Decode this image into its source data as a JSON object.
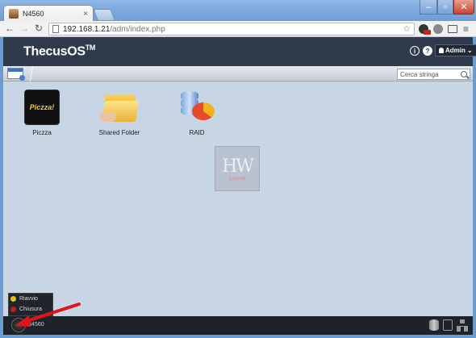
{
  "browser": {
    "tab_title": "N4560",
    "tab_close": "×",
    "window_controls": {
      "minimize": "–",
      "maximize": "▫",
      "close": "✕"
    },
    "nav": {
      "back": "←",
      "forward": "→",
      "reload": "↻"
    },
    "url_host": "192.168.1.21",
    "url_path": "/adm/index.php",
    "star": "☆",
    "menu": "≡"
  },
  "header": {
    "logo": "ThecusOS",
    "logo_tm": "TM",
    "info": "i",
    "help": "?",
    "user": "Admin",
    "user_caret": "⌄"
  },
  "search": {
    "placeholder": "Cerca stringa"
  },
  "desktop": {
    "apps": [
      {
        "label": "Piczza",
        "icon_text": "Piczza!",
        "icon": "piczza-icon"
      },
      {
        "label": "Shared Folder",
        "icon": "shared-folder-icon"
      },
      {
        "label": "RAID",
        "icon": "raid-icon"
      }
    ],
    "watermark": {
      "big": "HW",
      "small": "Legend"
    }
  },
  "popup_menu": {
    "items": [
      {
        "label": "Riavvio",
        "color": "#e4c21c"
      },
      {
        "label": "Chiusura",
        "color": "#b8201a"
      }
    ]
  },
  "taskbar": {
    "device": "N4560"
  },
  "colors": {
    "accent_arrow": "#e0141a",
    "header_bg": "#2f3a4c",
    "desktop_bg": "#c7d5e5"
  }
}
